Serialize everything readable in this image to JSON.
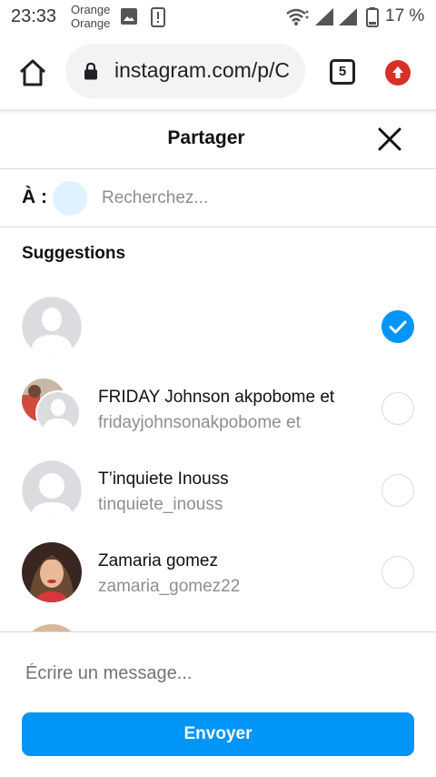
{
  "status_bar": {
    "time": "23:33",
    "carrier_line1": "Orange",
    "carrier_line2": "Orange",
    "battery": "17 %",
    "icons": [
      "image-icon",
      "alert-icon",
      "wifi-icon",
      "signal-icon",
      "signal-icon",
      "battery-icon"
    ]
  },
  "browser": {
    "url": "instagram.com/p/C",
    "tab_count": "5",
    "icons": [
      "home-icon",
      "lock-icon",
      "tabs-icon",
      "update-icon"
    ]
  },
  "dialog": {
    "title": "Partager",
    "to_label": "À :",
    "search_placeholder": "Recherchez...",
    "suggestions_title": "Suggestions",
    "suggestions": [
      {
        "name": "",
        "username": "",
        "selected": true,
        "avatar": "default-avatar"
      },
      {
        "name": "FRIDAY Johnson akpobome et",
        "username": "fridayjohnsonakpobome et",
        "selected": false,
        "avatar": "group-avatar"
      },
      {
        "name": "T’inquiete Inouss",
        "username": "tinquiete_inouss",
        "selected": false,
        "avatar": "default-avatar"
      },
      {
        "name": "Zamaria gomez",
        "username": "zamaria_gomez22",
        "selected": false,
        "avatar": "photo-avatar"
      }
    ],
    "message_placeholder": "Écrire un message...",
    "send_label": "Envoyer"
  },
  "colors": {
    "accent": "#0095f6",
    "update_red": "#d93025",
    "chip": "#e0f1ff"
  }
}
